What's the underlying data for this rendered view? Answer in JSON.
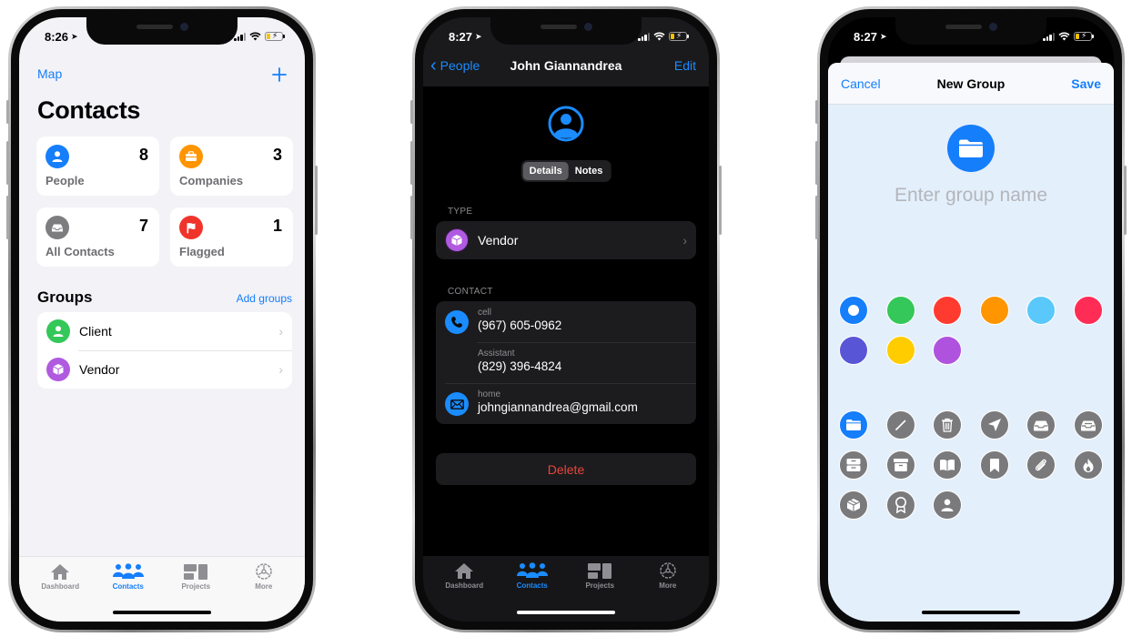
{
  "colors": {
    "ios_blue": "#157efb",
    "dark_blue": "#1a8cff",
    "destructive_red": "#e8453c"
  },
  "screen_contacts": {
    "status": {
      "time": "8:26"
    },
    "nav": {
      "left_link": "Map",
      "add_icon": "plus-icon"
    },
    "title": "Contacts",
    "tiles": [
      {
        "label": "People",
        "count": "8",
        "icon": "person-icon",
        "color": "#157efb"
      },
      {
        "label": "Companies",
        "count": "3",
        "icon": "briefcase-icon",
        "color": "#ff9500"
      },
      {
        "label": "All Contacts",
        "count": "7",
        "icon": "tray-icon",
        "color": "#7d7d80"
      },
      {
        "label": "Flagged",
        "count": "1",
        "icon": "flag-icon",
        "color": "#f0342b"
      }
    ],
    "groups": {
      "heading": "Groups",
      "add_label": "Add groups",
      "items": [
        {
          "name": "Client",
          "icon": "person-icon",
          "color": "#34c759"
        },
        {
          "name": "Vendor",
          "icon": "box-icon",
          "color": "#b05ae0"
        }
      ]
    },
    "tabbar": [
      {
        "label": "Dashboard",
        "icon": "house-icon",
        "active": false
      },
      {
        "label": "Contacts",
        "icon": "people-icon",
        "active": true
      },
      {
        "label": "Projects",
        "icon": "projects-icon",
        "active": false
      },
      {
        "label": "More",
        "icon": "gear-icon",
        "active": false
      }
    ]
  },
  "screen_detail": {
    "status": {
      "time": "8:27"
    },
    "nav": {
      "back_label": "People",
      "title": "John Giannandrea",
      "edit_label": "Edit"
    },
    "segments": [
      {
        "label": "Details",
        "active": true
      },
      {
        "label": "Notes",
        "active": false
      }
    ],
    "type_section": {
      "label": "TYPE",
      "value": "Vendor"
    },
    "contact_section": {
      "label": "CONTACT",
      "rows": [
        {
          "kind": "cell",
          "value": "(967) 605-0962",
          "icon": "phone-icon"
        },
        {
          "kind": "Assistant",
          "value": "(829) 396-4824",
          "icon": ""
        },
        {
          "kind": "home",
          "value": "johngiannandrea@gmail.com",
          "icon": "envelope-icon"
        }
      ]
    },
    "delete_label": "Delete",
    "tabbar": [
      {
        "label": "Dashboard",
        "icon": "house-icon",
        "active": false
      },
      {
        "label": "Contacts",
        "icon": "people-icon",
        "active": true
      },
      {
        "label": "Projects",
        "icon": "projects-icon",
        "active": false
      },
      {
        "label": "More",
        "icon": "gear-icon",
        "active": false
      }
    ]
  },
  "screen_new_group": {
    "status": {
      "time": "8:27"
    },
    "nav": {
      "cancel_label": "Cancel",
      "title": "New Group",
      "save_label": "Save"
    },
    "name_input": {
      "value": "",
      "placeholder": "Enter group name"
    },
    "color_options": [
      {
        "color": "#157efb",
        "selected": true
      },
      {
        "color": "#34c759",
        "selected": false
      },
      {
        "color": "#ff3b30",
        "selected": false
      },
      {
        "color": "#ff9500",
        "selected": false
      },
      {
        "color": "#5ac8fa",
        "selected": false
      },
      {
        "color": "#ff2d55",
        "selected": false
      },
      {
        "color": "#5856d6",
        "selected": false
      },
      {
        "color": "#ffcc00",
        "selected": false
      },
      {
        "color": "#af52de",
        "selected": false
      }
    ],
    "icon_options": [
      {
        "icon": "folder-icon",
        "selected": true
      },
      {
        "icon": "pencil-icon",
        "selected": false
      },
      {
        "icon": "trash-icon",
        "selected": false
      },
      {
        "icon": "paperplane-icon",
        "selected": false
      },
      {
        "icon": "tray-icon",
        "selected": false
      },
      {
        "icon": "tray-full-icon",
        "selected": false
      },
      {
        "icon": "tray-2-icon",
        "selected": false
      },
      {
        "icon": "archivebox-icon",
        "selected": false
      },
      {
        "icon": "book-icon",
        "selected": false
      },
      {
        "icon": "bookmark-icon",
        "selected": false
      },
      {
        "icon": "paperclip-icon",
        "selected": false
      },
      {
        "icon": "flame-icon",
        "selected": false
      },
      {
        "icon": "box-icon",
        "selected": false
      },
      {
        "icon": "rosette-icon",
        "selected": false
      },
      {
        "icon": "person-icon",
        "selected": false
      }
    ]
  }
}
